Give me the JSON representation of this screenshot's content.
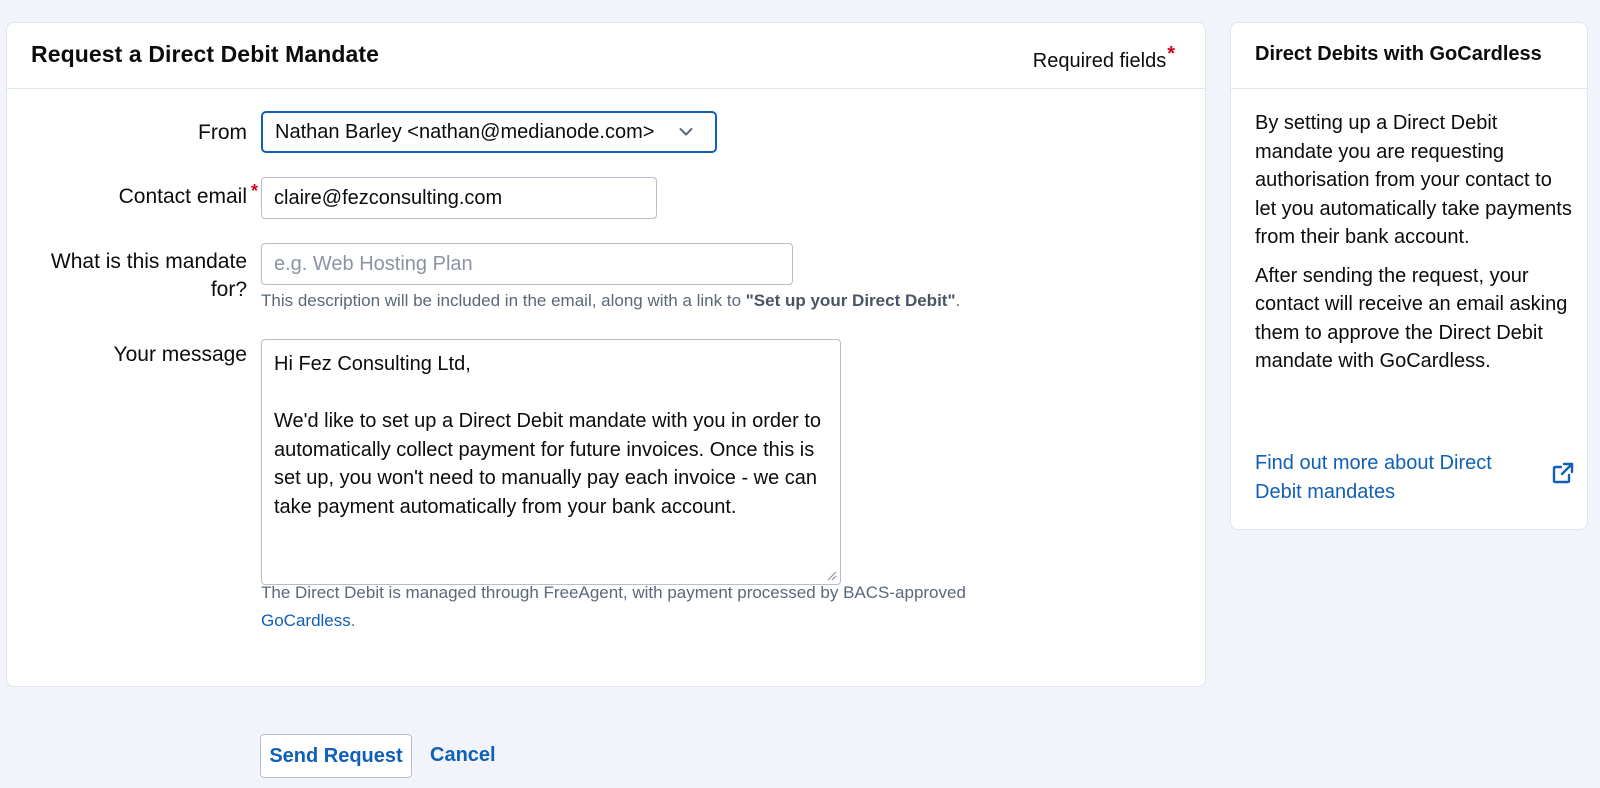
{
  "form": {
    "title": "Request a Direct Debit Mandate",
    "required_note": "Required fields",
    "required_star": "*",
    "from": {
      "label": "From",
      "value": "Nathan Barley <nathan@medianode.com>"
    },
    "contact_email": {
      "label": "Contact email",
      "value": "claire@fezconsulting.com"
    },
    "mandate_for": {
      "label": "What is this mandate for?",
      "placeholder": "e.g. Web Hosting Plan",
      "hint_prefix": "This description will be included in the email, along with a link to ",
      "hint_strong": "\"Set up your Direct Debit\"",
      "hint_suffix": "."
    },
    "message": {
      "label": "Your message",
      "value": "Hi Fez Consulting Ltd,\n\nWe'd like to set up a Direct Debit mandate with you in order to automatically collect payment for future invoices. Once this is set up, you won't need to manually pay each invoice - we can take payment automatically from your bank account."
    },
    "footer_hint": {
      "text": "The Direct Debit is managed through FreeAgent, with payment processed by BACS-approved ",
      "link": "GoCardless",
      "suffix": "."
    }
  },
  "sidebar": {
    "title": "Direct Debits with GoCardless",
    "paragraph_1": "By setting up a Direct Debit mandate you are requesting authorisation from your contact to let you automatically take payments from their bank account.",
    "paragraph_2": "After sending the request, your contact will receive an email asking them to approve the Direct Debit mandate with GoCardless.",
    "link": "Find out more about Direct Debit mandates",
    "link_icon": "external-link-icon"
  },
  "actions": {
    "send_label": "Send Request",
    "cancel_label": "Cancel"
  },
  "colors": {
    "accent": "#0f60b6",
    "required": "#d0021b",
    "background": "#f1f4fa"
  }
}
